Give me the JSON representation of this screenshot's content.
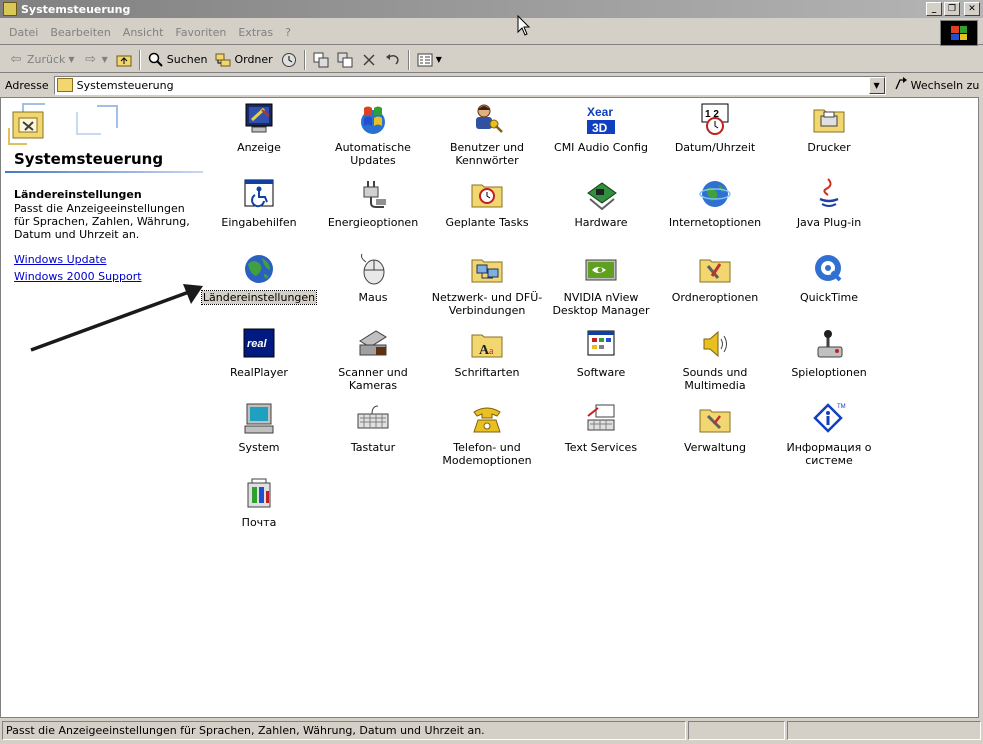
{
  "window": {
    "title": "Systemsteuerung"
  },
  "menu": [
    "Datei",
    "Bearbeiten",
    "Ansicht",
    "Favoriten",
    "Extras",
    "?"
  ],
  "toolbar": {
    "back": "Zurück",
    "search": "Suchen",
    "folders": "Ordner"
  },
  "address": {
    "label": "Adresse",
    "value": "Systemsteuerung",
    "go": "Wechseln zu"
  },
  "sidebar": {
    "title": "Systemsteuerung",
    "heading": "Ländereinstellungen",
    "description": "Passt die Anzeigeeinstellungen für Sprachen, Zahlen, Währung, Datum und Uhrzeit an.",
    "links": [
      "Windows Update",
      "Windows 2000 Support"
    ]
  },
  "items": [
    {
      "label": "Anzeige",
      "icon": "display-icon"
    },
    {
      "label": "Automatische Updates",
      "icon": "windows-update-icon"
    },
    {
      "label": "Benutzer und Kennwörter",
      "icon": "users-keys-icon"
    },
    {
      "label": "CMI Audio Config",
      "icon": "audio-3d-icon"
    },
    {
      "label": "Datum/Uhrzeit",
      "icon": "calendar-clock-icon"
    },
    {
      "label": "Drucker",
      "icon": "printer-folder-icon"
    },
    {
      "label": "Eingabehilfen",
      "icon": "accessibility-icon"
    },
    {
      "label": "Energieoptionen",
      "icon": "power-plug-icon"
    },
    {
      "label": "Geplante Tasks",
      "icon": "scheduled-tasks-icon"
    },
    {
      "label": "Hardware",
      "icon": "hardware-icon"
    },
    {
      "label": "Internetoptionen",
      "icon": "globe-icon"
    },
    {
      "label": "Java Plug-in",
      "icon": "java-icon"
    },
    {
      "label": "Ländereinstellungen",
      "icon": "earth-icon",
      "selected": true
    },
    {
      "label": "Maus",
      "icon": "mouse-icon"
    },
    {
      "label": "Netzwerk- und DFÜ-Verbindungen",
      "icon": "network-folder-icon"
    },
    {
      "label": "NVIDIA nView Desktop Manager",
      "icon": "nvidia-icon"
    },
    {
      "label": "Ordneroptionen",
      "icon": "folder-options-icon"
    },
    {
      "label": "QuickTime",
      "icon": "quicktime-icon"
    },
    {
      "label": "RealPlayer",
      "icon": "realplayer-icon"
    },
    {
      "label": "Scanner und Kameras",
      "icon": "scanner-icon"
    },
    {
      "label": "Schriftarten",
      "icon": "fonts-folder-icon"
    },
    {
      "label": "Software",
      "icon": "software-icon"
    },
    {
      "label": "Sounds und Multimedia",
      "icon": "speaker-icon"
    },
    {
      "label": "Spieloptionen",
      "icon": "joystick-icon"
    },
    {
      "label": "System",
      "icon": "computer-icon"
    },
    {
      "label": "Tastatur",
      "icon": "keyboard-icon"
    },
    {
      "label": "Telefon- und Modemoptionen",
      "icon": "telephone-icon"
    },
    {
      "label": "Text Services",
      "icon": "text-services-icon"
    },
    {
      "label": "Verwaltung",
      "icon": "admin-tools-icon"
    },
    {
      "label": "Информация о системе",
      "icon": "info-diamond-icon"
    },
    {
      "label": "Почта",
      "icon": "mail-icon"
    }
  ],
  "status": {
    "text": "Passt die Anzeigeeinstellungen für Sprachen, Zahlen, Währung, Datum und Uhrzeit an."
  }
}
